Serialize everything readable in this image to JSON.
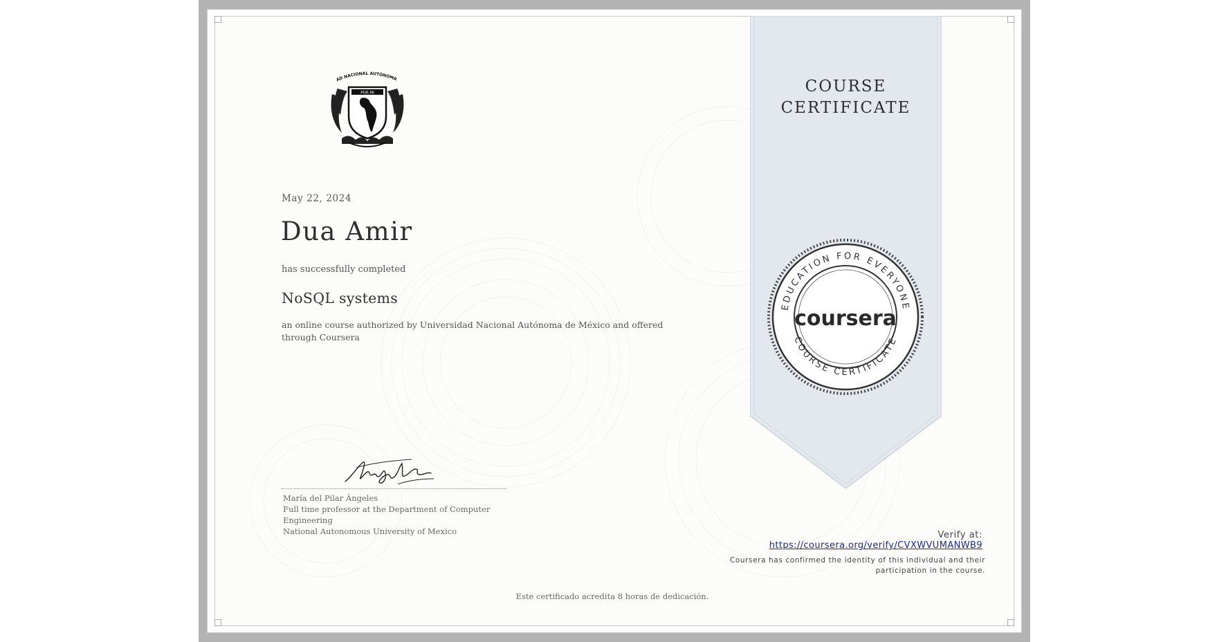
{
  "certificate": {
    "ribbon_title_line1": "COURSE",
    "ribbon_title_line2": "CERTIFICATE",
    "date": "May 22, 2024",
    "recipient_name": "Dua Amir",
    "completed_text": "has successfully completed",
    "course_name": "NoSQL systems",
    "description": "an online course authorized by Universidad Nacional Autónoma de México and offered through Coursera",
    "logo_caption": "UNIVERSIDAD NACIONAL AUTÓNOMA DE MÉXICO",
    "logo_motto": "POR MI RAZA HABLARÁ EL ESPÍRITU"
  },
  "signer": {
    "name": "María del Pilar Ángeles",
    "title": "Full time professor at the Department of Computer Engineering",
    "institution": "National Autonomous University of Mexico"
  },
  "seal": {
    "brand": "coursera",
    "top_text": "EDUCATION FOR EVERYONE",
    "bottom_text": "COURSE CERTIFICATE"
  },
  "verification": {
    "label": "Verify at:",
    "url": "https://coursera.org/verify/CVXWVUMANWB9",
    "note": "Coursera has confirmed the identity of this individual and their participation in the course."
  },
  "footer": {
    "hours_note": "Este certificado acredita 8 horas de dedicación."
  },
  "colors": {
    "frame": "#b3b3b3",
    "ribbon": "#e3e7ee",
    "link": "#1d2a8a"
  }
}
